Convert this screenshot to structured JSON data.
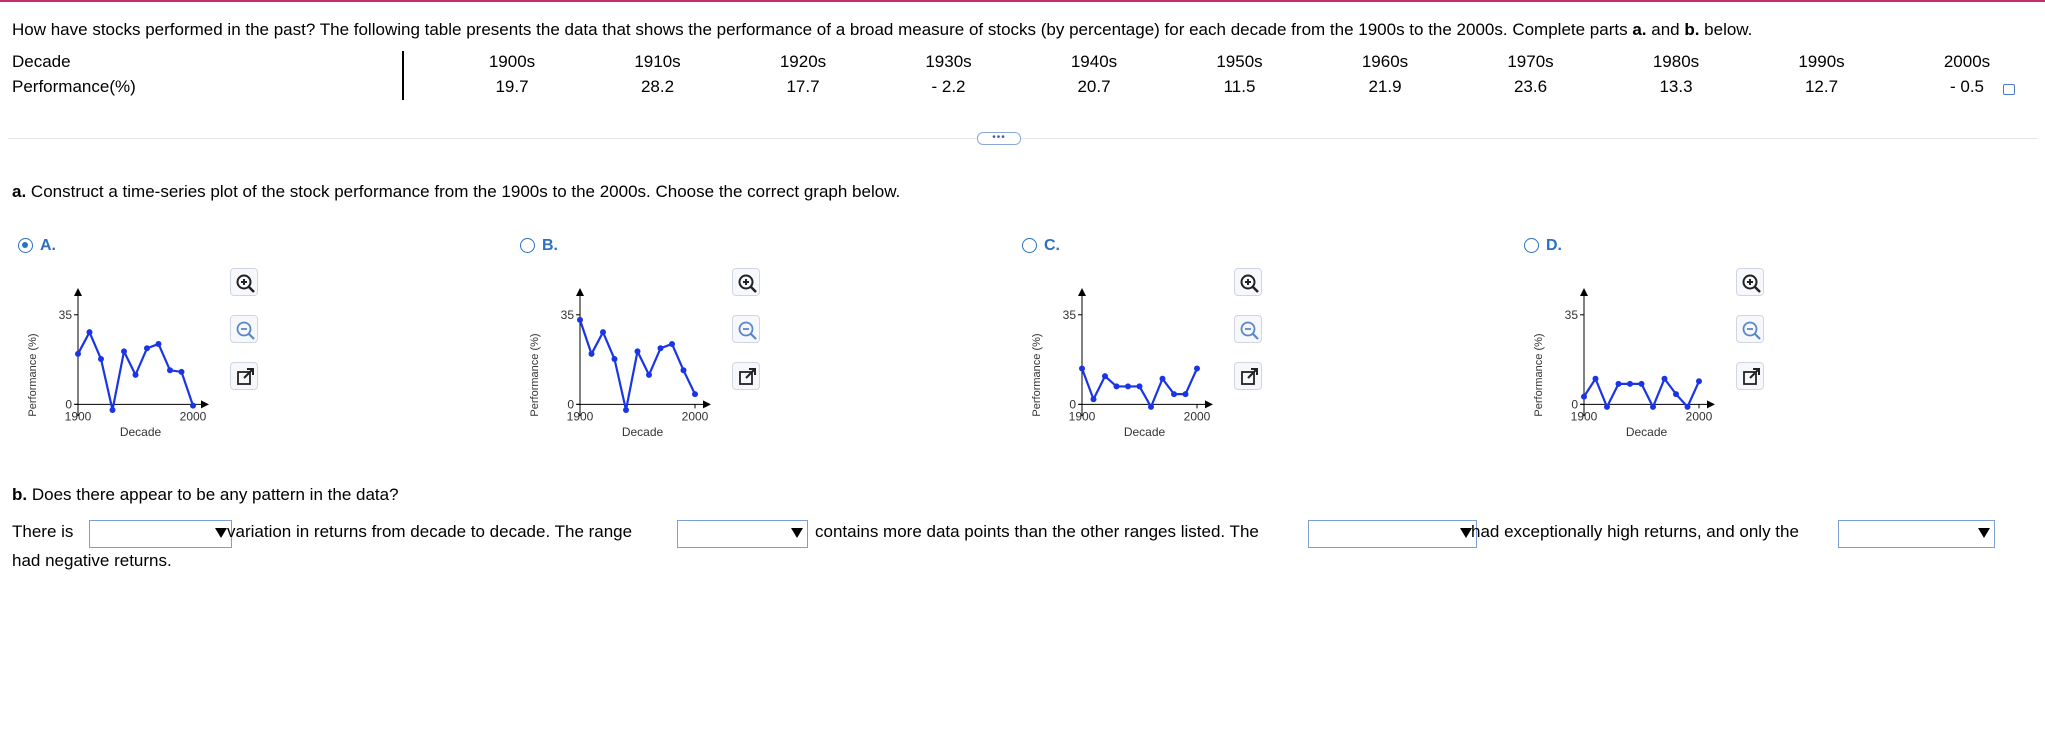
{
  "question": {
    "text_before": "How have stocks performed in the past? The following table presents the data that shows the performance of a broad measure of stocks (by percentage) for each decade from the 1900s to the 2000s. Complete parts ",
    "a": "a.",
    "and": " and ",
    "b": "b.",
    "text_after": " below."
  },
  "table": {
    "row1_label": "Decade",
    "row2_label": "Performance(%)",
    "decades": [
      "1900s",
      "1910s",
      "1920s",
      "1930s",
      "1940s",
      "1950s",
      "1960s",
      "1970s",
      "1980s",
      "1990s",
      "2000s"
    ],
    "performance": [
      "19.7",
      "28.2",
      "17.7",
      "- 2.2",
      "20.7",
      "11.5",
      "21.9",
      "23.6",
      "13.3",
      "12.7",
      "- 0.5"
    ]
  },
  "more_button": "•••",
  "part_a": {
    "letter": "a.",
    "text": " Construct a time-series plot of the stock performance from the 1900s to the 2000s. Choose the correct graph below."
  },
  "options": [
    {
      "label": "A.",
      "selected": true
    },
    {
      "label": "B.",
      "selected": false
    },
    {
      "label": "C.",
      "selected": false
    },
    {
      "label": "D.",
      "selected": false
    }
  ],
  "chart_data": [
    {
      "type": "line",
      "option": "A",
      "x": [
        1900,
        1910,
        1920,
        1930,
        1940,
        1950,
        1960,
        1970,
        1980,
        1990,
        2000
      ],
      "values": [
        19.7,
        28.2,
        17.7,
        -2.2,
        20.7,
        11.5,
        21.9,
        23.6,
        13.3,
        12.7,
        -0.5
      ],
      "xlabel": "Decade",
      "ylabel": "Performance (%)",
      "xticks": [
        "1900",
        "2000"
      ],
      "yticks": [
        "0",
        "35"
      ],
      "ylim": [
        -3,
        40
      ]
    },
    {
      "type": "line",
      "option": "B",
      "x": [
        1900,
        1910,
        1920,
        1930,
        1940,
        1950,
        1960,
        1970,
        1980,
        1990,
        2000
      ],
      "values": [
        33,
        19.7,
        28.2,
        17.7,
        -2.2,
        20.7,
        11.5,
        21.9,
        23.6,
        13.3,
        4
      ],
      "xlabel": "Decade",
      "ylabel": "Performance (%)",
      "xticks": [
        "1900",
        "2000"
      ],
      "yticks": [
        "0",
        "35"
      ],
      "ylim": [
        -3,
        40
      ]
    },
    {
      "type": "line",
      "option": "C",
      "x": [
        1900,
        1910,
        1920,
        1930,
        1940,
        1950,
        1960,
        1970,
        1980,
        1990,
        2000
      ],
      "values": [
        14,
        2,
        11,
        7,
        7,
        7,
        -1,
        10,
        4,
        4,
        14
      ],
      "xlabel": "Decade",
      "ylabel": "Performance (%)",
      "xticks": [
        "1900",
        "2000"
      ],
      "yticks": [
        "0",
        "35"
      ],
      "ylim": [
        -3,
        40
      ]
    },
    {
      "type": "line",
      "option": "D",
      "x": [
        1900,
        1910,
        1920,
        1930,
        1940,
        1950,
        1960,
        1970,
        1980,
        1990,
        2000
      ],
      "values": [
        3,
        10,
        -1,
        8,
        8,
        8,
        -1,
        10,
        4,
        -1,
        9
      ],
      "xlabel": "Decade",
      "ylabel": "Performance (%)",
      "xticks": [
        "1900",
        "2000"
      ],
      "yticks": [
        "0",
        "35"
      ],
      "ylim": [
        -3,
        40
      ]
    }
  ],
  "part_b": {
    "letter": "b.",
    "text": " Does there appear to be any pattern in the data?",
    "s1": "There is",
    "s2": "variation in returns from decade to decade. The range",
    "s3": "contains more data points than the other ranges listed. The",
    "s4": "had exceptionally high returns, and only the",
    "s5": "had negative returns.",
    "dropdown_values": [
      "",
      "",
      "",
      ""
    ]
  },
  "colors": {
    "accent": "#2d6fc0",
    "series": "#1a35e6",
    "top_border": "#c0306a"
  }
}
